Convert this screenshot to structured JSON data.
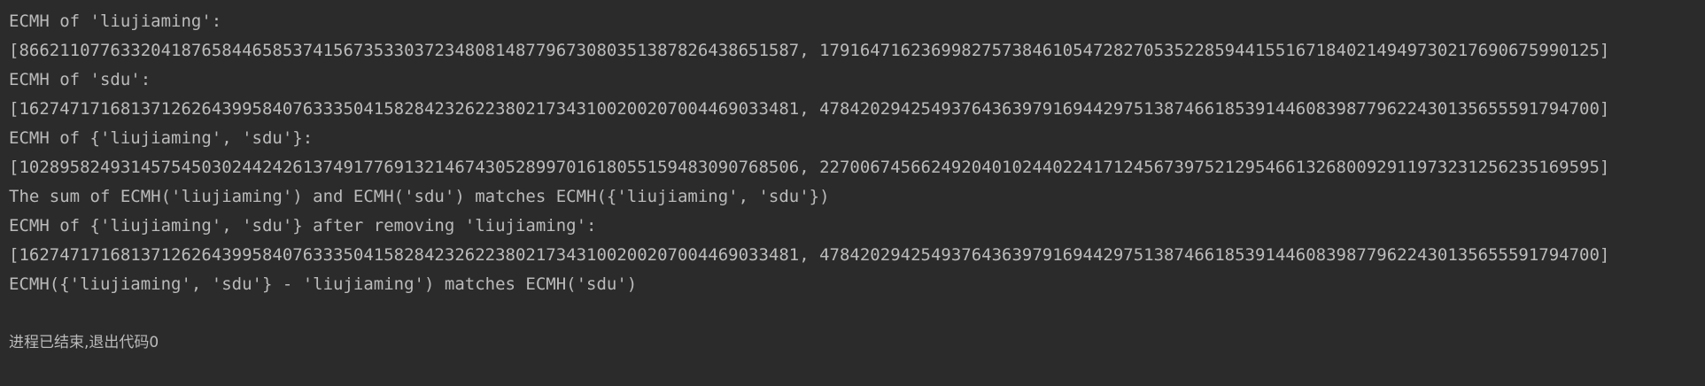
{
  "console": {
    "lines": [
      "ECMH of 'liujiaming':",
      "[86621107763320418765844658537415673533037234808148779673080351387826438651587, 17916471623699827573846105472827053522859441551671840214949730217690675990125]",
      "ECMH of 'sdu':",
      "[16274717168137126264399584076333504158284232622380217343100200207004469033481, 47842029425493764363979169442975138746618539144608398779622430135655591794700]",
      "ECMH of {'liujiaming', 'sdu'}:",
      "[10289582493145754503024424261374917769132146743052899701618055159483090768506, 22700674566249204010244022417124567397521295466132680092911973231256235169595]",
      "The sum of ECMH('liujiaming') and ECMH('sdu') matches ECMH({'liujiaming', 'sdu'})",
      "ECMH of {'liujiaming', 'sdu'} after removing 'liujiaming':",
      "[16274717168137126264399584076333504158284232622380217343100200207004469033481, 47842029425493764363979169442975138746618539144608398779622430135655591794700]",
      "ECMH({'liujiaming', 'sdu'} - 'liujiaming') matches ECMH('sdu')"
    ],
    "exit_message": "进程已结束,退出代码0"
  }
}
